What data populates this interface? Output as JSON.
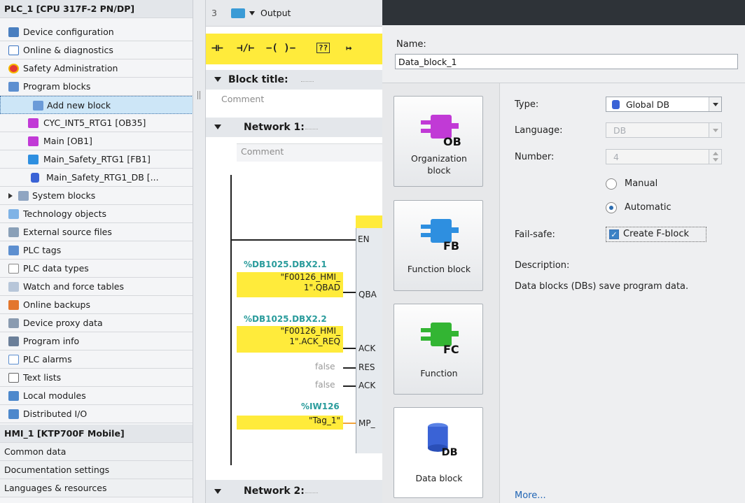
{
  "project_tree": {
    "plc_header": "PLC_1 [CPU 317F-2 PN/DP]",
    "items": [
      {
        "label": "Device configuration",
        "icon": "device-config-icon"
      },
      {
        "label": "Online & diagnostics",
        "icon": "online-diagnostics-icon"
      },
      {
        "label": "Safety Administration",
        "icon": "safety-icon"
      },
      {
        "label": "Program blocks",
        "icon": "folder-icon"
      },
      {
        "label": "Add new block",
        "icon": "add-block-icon"
      },
      {
        "label": "CYC_INT5_RTG1 [OB35]",
        "icon": "ob-icon"
      },
      {
        "label": "Main [OB1]",
        "icon": "ob-icon"
      },
      {
        "label": "Main_Safety_RTG1 [FB1]",
        "icon": "fb-icon"
      },
      {
        "label": "Main_Safety_RTG1_DB [...",
        "icon": "db-icon"
      },
      {
        "label": "System blocks",
        "icon": "folder-icon"
      },
      {
        "label": "Technology objects",
        "icon": "technology-icon"
      },
      {
        "label": "External source files",
        "icon": "source-files-icon"
      },
      {
        "label": "PLC tags",
        "icon": "tags-icon"
      },
      {
        "label": "PLC data types",
        "icon": "data-types-icon"
      },
      {
        "label": "Watch and force tables",
        "icon": "watch-icon"
      },
      {
        "label": "Online backups",
        "icon": "backup-icon"
      },
      {
        "label": "Device proxy data",
        "icon": "proxy-icon"
      },
      {
        "label": "Program info",
        "icon": "program-info-icon"
      },
      {
        "label": "PLC alarms",
        "icon": "alarm-icon"
      },
      {
        "label": "Text lists",
        "icon": "text-list-icon"
      },
      {
        "label": "Local modules",
        "icon": "folder-icon"
      },
      {
        "label": "Distributed I/O",
        "icon": "folder-icon"
      }
    ],
    "hmi_header": "HMI_1 [KTP700F Mobile]",
    "footer_items": [
      "Common data",
      "Documentation settings",
      "Languages & resources"
    ]
  },
  "editor": {
    "line_number": "3",
    "output_label": "Output",
    "ladder_symbols": [
      "⊣⊢",
      "⊣/⊢",
      "−( )−",
      "??",
      "↦"
    ],
    "block_title": "Block title:",
    "comment": "Comment",
    "network1_title": "Network 1:",
    "network2_title": "Network 2:",
    "pins": {
      "en": "EN",
      "qbad": "QBA",
      "ack_req": "ACK",
      "res": "RES",
      "ack2": "ACK",
      "mp": "MP_"
    },
    "operands": {
      "addr1": "%DB1025.DBX2.1",
      "tag1_line1": "\"F00126_HMI_",
      "tag1_line2": "1\".QBAD",
      "addr2": "%DB1025.DBX2.2",
      "tag2_line1": "\"F00126_HMI_",
      "tag2_line2": "1\".ACK_REQ",
      "false1": "false",
      "false2": "false",
      "addr3": "%IW126",
      "tag3": "\"Tag_1\""
    }
  },
  "dialog": {
    "name_label": "Name:",
    "name_value": "Data_block_1",
    "block_types": [
      {
        "label": "Organization block",
        "icon": "organization-block-icon",
        "badge": "OB",
        "color": "#c13ad6"
      },
      {
        "label": "Function block",
        "icon": "function-block-icon",
        "badge": "FB",
        "color": "#2e8fe0"
      },
      {
        "label": "Function",
        "icon": "function-icon",
        "badge": "FC",
        "color": "#33b533"
      },
      {
        "label": "Data block",
        "icon": "data-block-icon",
        "badge": "DB",
        "color": "#3a63d6"
      }
    ],
    "type_label": "Type:",
    "type_value": "Global DB",
    "language_label": "Language:",
    "language_value": "DB",
    "number_label": "Number:",
    "number_value": "4",
    "manual_label": "Manual",
    "automatic_label": "Automatic",
    "failsafe_label": "Fail-safe:",
    "create_fblock_label": "Create F-block",
    "description_label": "Description:",
    "description_text": "Data blocks (DBs) save program data.",
    "more_link": "More..."
  }
}
